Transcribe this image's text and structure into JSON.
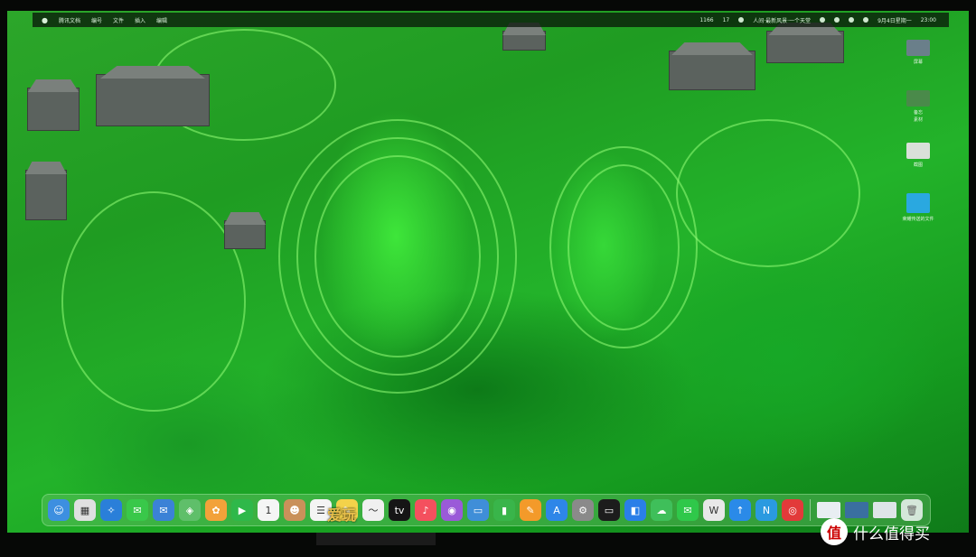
{
  "menubar": {
    "apple_icon": "apple-icon",
    "items": [
      "腾讯文档",
      "编号",
      "文件",
      "插入",
      "编辑"
    ],
    "right_items": [
      "1166",
      "17",
      "人间·最新风景·一个天堂",
      "9月4日星期一",
      "23:00"
    ]
  },
  "desktop_icons": [
    {
      "label": "屏幕",
      "color": "#6a7f8a"
    },
    {
      "label": "备忘",
      "color": "#4a8a4a"
    },
    {
      "label": "素材",
      "color": "#3a7a3a"
    },
    {
      "label": "截图",
      "color": "#d9e0d9"
    },
    {
      "label": "荣耀传送的文件",
      "color": "#2aa8e0"
    }
  ],
  "dock": {
    "apps": [
      {
        "name": "finder",
        "color": "#3d8fe0",
        "glyph": "☺"
      },
      {
        "name": "launchpad",
        "color": "#e0e0e0",
        "glyph": "▦"
      },
      {
        "name": "safari",
        "color": "#2a7fd9",
        "glyph": "✧"
      },
      {
        "name": "messages",
        "color": "#39c84a",
        "glyph": "✉"
      },
      {
        "name": "mail",
        "color": "#3b82d6",
        "glyph": "✉"
      },
      {
        "name": "maps",
        "color": "#5fbf6a",
        "glyph": "◈"
      },
      {
        "name": "photos",
        "color": "#f2a23a",
        "glyph": "✿"
      },
      {
        "name": "facetime",
        "color": "#2fb84a",
        "glyph": "▶"
      },
      {
        "name": "calendar",
        "color": "#f5f5f5",
        "glyph": "1"
      },
      {
        "name": "contacts",
        "color": "#c9915a",
        "glyph": "☻"
      },
      {
        "name": "reminders",
        "color": "#f4f4f4",
        "glyph": "☰"
      },
      {
        "name": "notes",
        "color": "#f3d24a",
        "glyph": "✎"
      },
      {
        "name": "freeform",
        "color": "#f0f0f0",
        "glyph": "〜"
      },
      {
        "name": "tv",
        "color": "#151515",
        "glyph": "tv"
      },
      {
        "name": "music",
        "color": "#f4505e",
        "glyph": "♪"
      },
      {
        "name": "podcasts",
        "color": "#9a5ad8",
        "glyph": "◉"
      },
      {
        "name": "keynote",
        "color": "#3f8ed8",
        "glyph": "▭"
      },
      {
        "name": "numbers",
        "color": "#39b54a",
        "glyph": "▮"
      },
      {
        "name": "pages",
        "color": "#f39a2a",
        "glyph": "✎"
      },
      {
        "name": "app-store",
        "color": "#2e86e8",
        "glyph": "A"
      },
      {
        "name": "system-settings",
        "color": "#8a8a8a",
        "glyph": "⚙"
      },
      {
        "name": "terminal",
        "color": "#1c1c1c",
        "glyph": "▭"
      },
      {
        "name": "wps-cloud",
        "color": "#2a7fe8",
        "glyph": "◧"
      },
      {
        "name": "wechat-work",
        "color": "#3fbf5a",
        "glyph": "☁"
      },
      {
        "name": "wechat",
        "color": "#2fc84a",
        "glyph": "✉"
      },
      {
        "name": "wps-office",
        "color": "#e8e8e8",
        "glyph": "W"
      },
      {
        "name": "dingtalk",
        "color": "#2a8ae8",
        "glyph": "↑"
      },
      {
        "name": "n-app",
        "color": "#2a9ae0",
        "glyph": "N"
      },
      {
        "name": "netease-music",
        "color": "#e23a3a",
        "glyph": "◎"
      }
    ],
    "recent": [
      {
        "name": "recent-window-1",
        "color": "#e8eef2"
      },
      {
        "name": "recent-window-2",
        "color": "#3a6fa0"
      },
      {
        "name": "recent-window-3",
        "color": "#dde5e8"
      }
    ],
    "trash_icon": "trash-icon"
  },
  "watermark": {
    "site_text": "爱玩",
    "logo_glyph": "值",
    "text": "什么值得买"
  }
}
